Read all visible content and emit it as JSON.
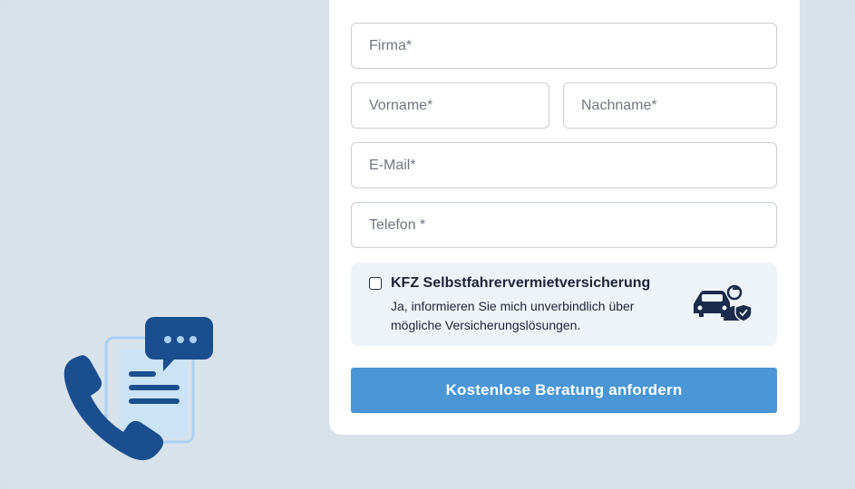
{
  "form": {
    "company_placeholder": "Firma*",
    "firstname_placeholder": "Vorname*",
    "lastname_placeholder": "Nachname*",
    "email_placeholder": "E-Mail*",
    "phone_placeholder": "Telefon *",
    "consent": {
      "title": "KFZ Selbstfahrervermietversicherung",
      "text_line1": "Ja, informieren Sie mich unverbindlich über",
      "text_line2": "mögliche Versicherungslösungen.",
      "checked": false,
      "icon": "car-insurance-icon"
    },
    "submit_label": "Kostenlose Beratung anfordern"
  },
  "decor": {
    "icon": "phone-chat-document-icon"
  },
  "colors": {
    "background": "#d8e2eb",
    "card": "#ffffff",
    "accent": "#4a96d6",
    "navy": "#1b4e8f",
    "light_blue": "#a9d0f5"
  }
}
